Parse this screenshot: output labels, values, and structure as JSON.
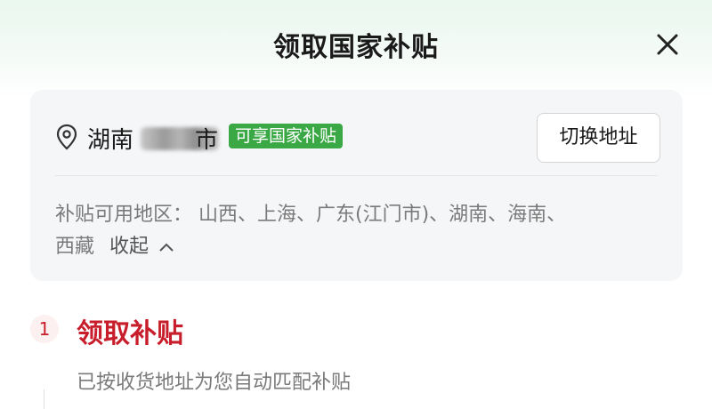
{
  "header": {
    "title": "领取国家补贴"
  },
  "address": {
    "city_prefix": "湖南",
    "city_suffix": "市",
    "badge": "可享国家补贴",
    "switch_label": "切换地址",
    "regions_line1": "补贴可用地区：  山西、上海、广东(江门市)、湖南、海南、",
    "regions_line2": "西藏",
    "collapse_label": "收起"
  },
  "steps": [
    {
      "number": "1",
      "title": "领取补贴",
      "desc": "已按收货地址为您自动匹配补贴"
    }
  ],
  "colors": {
    "accent": "#c81e2b",
    "badge": "#3aa844"
  }
}
